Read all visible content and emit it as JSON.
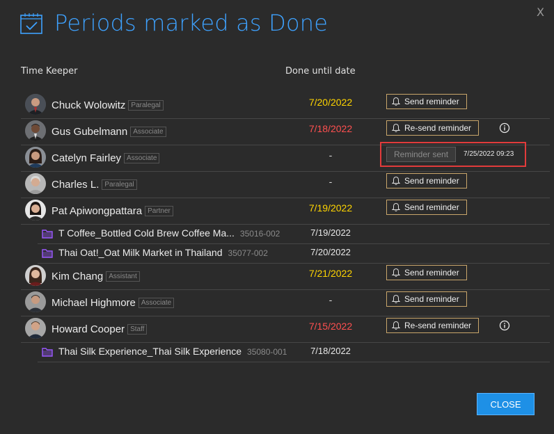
{
  "dialog": {
    "title": "Periods marked as Done",
    "close_x": "X",
    "close_button": "CLOSE"
  },
  "columns": {
    "timekeeper": "Time Keeper",
    "done_until": "Done until date"
  },
  "rows": [
    {
      "name": "Chuck Wolowitz",
      "role": "Paralegal",
      "date": "7/20/2022",
      "action": "Send reminder"
    },
    {
      "name": "Gus Gubelmann",
      "role": "Associate",
      "date": "7/18/2022",
      "action": "Re-send reminder"
    },
    {
      "name": "Catelyn Fairley",
      "role": "Associate",
      "date": "-",
      "action": "Reminder sent",
      "sent_time": "7/25/2022 09:23"
    },
    {
      "name": "Charles L.",
      "role": "Paralegal",
      "date": "-",
      "action": "Send reminder"
    },
    {
      "name": "Pat Apiwongpattara",
      "role": "Partner",
      "date": "7/19/2022",
      "action": "Send reminder",
      "projects": [
        {
          "name": "T Coffee_Bottled Cold Brew Coffee Ma...",
          "code": "35016-002",
          "date": "7/19/2022"
        },
        {
          "name": "Thai Oat!_Oat Milk Market in Thailand",
          "code": "35077-002",
          "date": "7/20/2022"
        }
      ]
    },
    {
      "name": "Kim Chang",
      "role": "Assistant",
      "date": "7/21/2022",
      "action": "Send reminder"
    },
    {
      "name": "Michael Highmore",
      "role": "Associate",
      "date": "-",
      "action": "Send reminder"
    },
    {
      "name": "Howard Cooper",
      "role": "Staff",
      "date": "7/15/2022",
      "action": "Re-send reminder",
      "projects": [
        {
          "name": "Thai Silk Experience_Thai Silk Experience",
          "code": "35080-001",
          "date": "7/18/2022"
        }
      ]
    }
  ],
  "colors": {
    "accent": "#3ea2ff",
    "overdue": "#ff5050",
    "pending": "#ffd500",
    "button_border": "#c9a66b",
    "folder": "#9b59ff",
    "highlight": "#e23b3b"
  }
}
